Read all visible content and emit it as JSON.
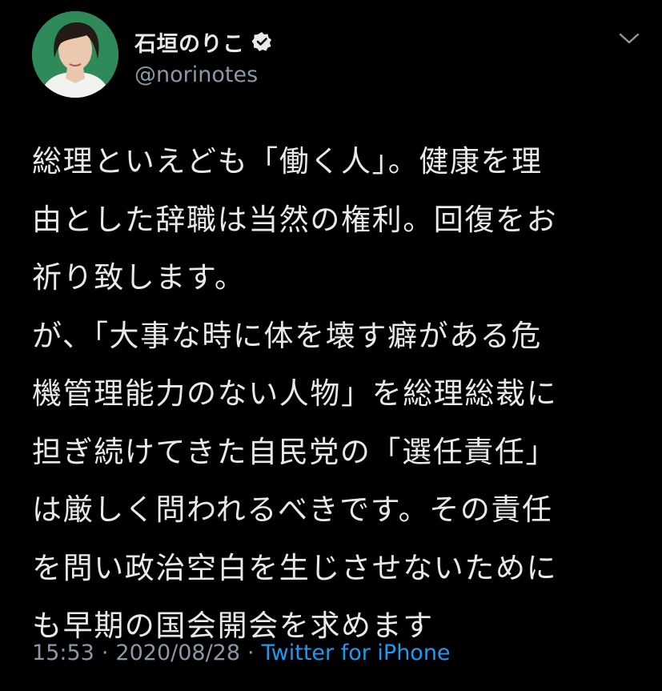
{
  "user": {
    "display_name": "石垣のりこ",
    "handle": "@norinotes",
    "verified": true
  },
  "tweet": {
    "lines": [
      "総理といえども「働く人」。健康を理",
      "由とした辞職は当然の権利。回復をお",
      "祈り致します。",
      "が、「大事な時に体を壊す癖がある危",
      "機管理能力のない人物」を総理総裁に",
      "担ぎ続けてきた自民党の「選任責任」",
      "は厳しく問われるべきです。その責任",
      "を問い政治空白を生じさせないために",
      "も早期の国会開会を求めます"
    ]
  },
  "meta": {
    "time": "15:53",
    "separator": "·",
    "date": "2020/08/28",
    "source": "Twitter for iPhone"
  },
  "icons": {
    "verified": "verified-badge-icon",
    "menu": "chevron-down-icon"
  },
  "colors": {
    "background": "#000000",
    "text": "#e7e9ea",
    "secondary": "#8b98a5",
    "link": "#1d9bf0"
  }
}
